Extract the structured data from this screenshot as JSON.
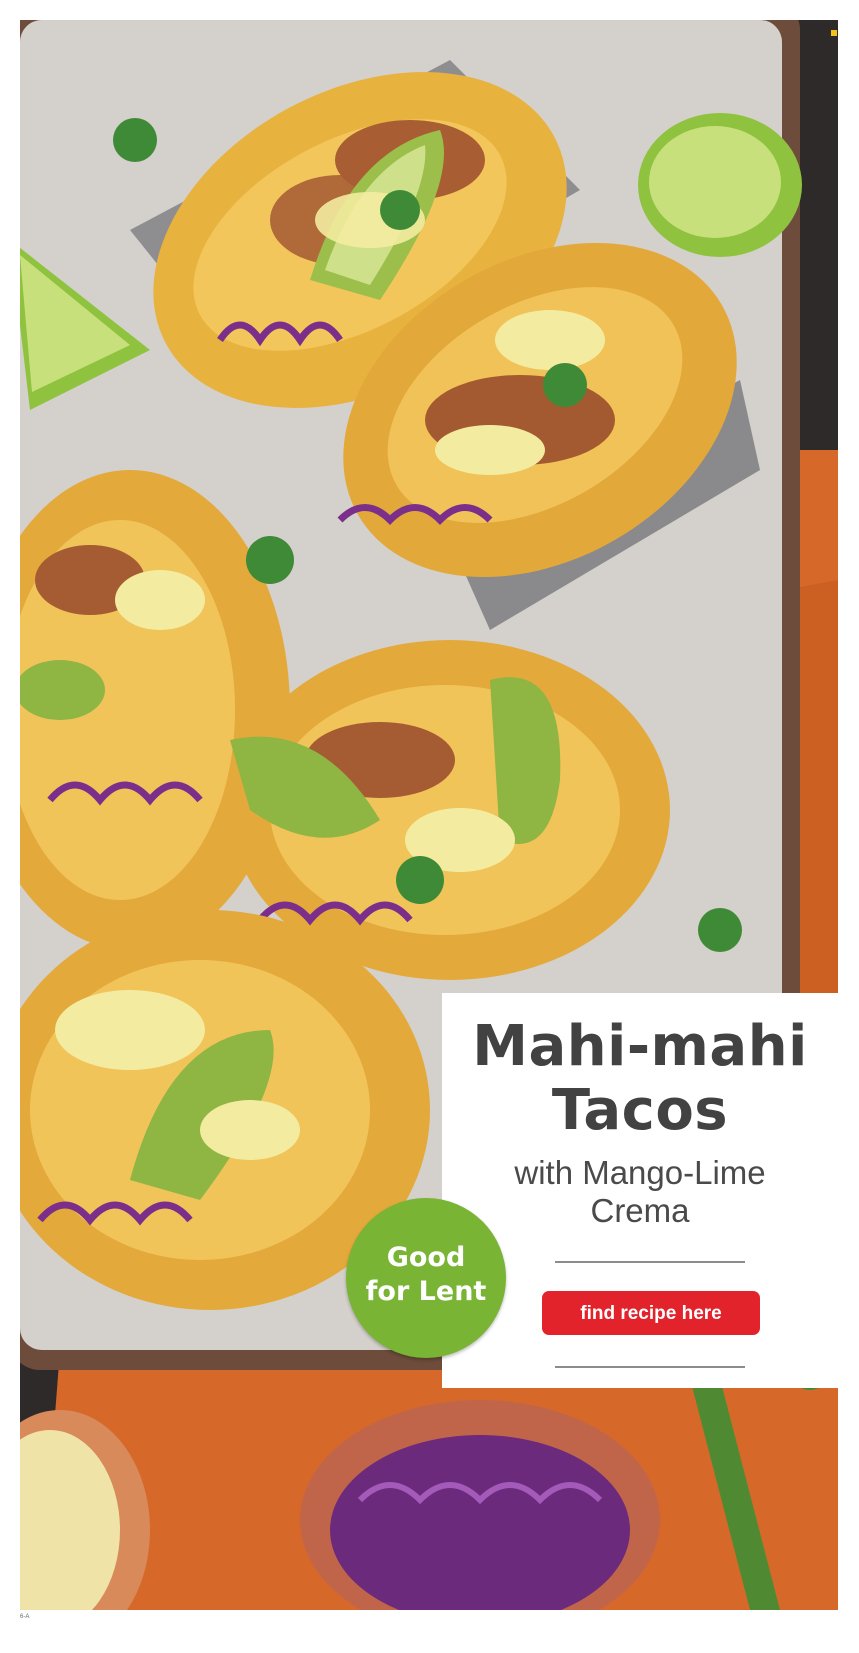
{
  "colors": {
    "title_text": "#424242",
    "accent_red": "#e2232c",
    "badge_green": "#7ab435",
    "cloth_orange": "#d6692a"
  },
  "feature": {
    "title_line_1": "Mahi-mahi",
    "title_line_2": "Tacos",
    "subtitle_line_1": "with Mango-Lime",
    "subtitle_line_2": "Crema"
  },
  "badge": {
    "line_1": "Good",
    "line_2": "for Lent"
  },
  "cta": {
    "label": "find recipe here"
  },
  "footer": {
    "page_code": "6-A"
  }
}
